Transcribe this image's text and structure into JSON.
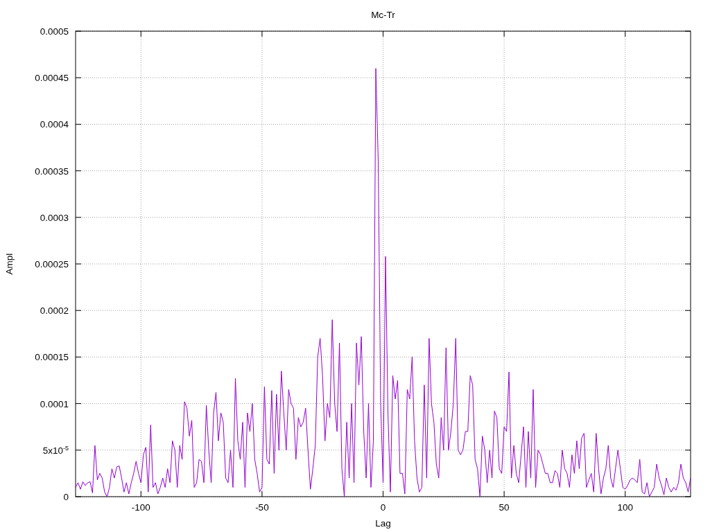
{
  "chart_data": {
    "type": "line",
    "grid": true,
    "title": "Mc-Tr",
    "xlabel": "Lag",
    "ylabel": "Ampl",
    "xlim": [
      -127,
      127
    ],
    "ylim": [
      0,
      0.0005
    ],
    "xticks": [
      -100,
      -50,
      0,
      50,
      100
    ],
    "yticks": [
      0,
      {
        "value": 5e-05,
        "label": "5x10$^{-5}$"
      },
      {
        "value": 0.0001,
        "label": "0.0001"
      },
      {
        "value": 0.00015,
        "label": "0.00015"
      },
      {
        "value": 0.0002,
        "label": "0.0002"
      },
      {
        "value": 0.00025,
        "label": "0.00025"
      },
      {
        "value": 0.0003,
        "label": "0.0003"
      },
      {
        "value": 0.00035,
        "label": "0.00035"
      },
      {
        "value": 0.0004,
        "label": "0.0004"
      },
      {
        "value": 0.00045,
        "label": "0.00045"
      },
      {
        "value": 0.0005,
        "label": "0.0005"
      }
    ],
    "x": [
      -127,
      -126,
      -125,
      -124,
      -123,
      -122,
      -121,
      -120,
      -119,
      -118,
      -117,
      -116,
      -115,
      -114,
      -113,
      -112,
      -111,
      -110,
      -109,
      -108,
      -107,
      -106,
      -105,
      -104,
      -103,
      -102,
      -101,
      -100,
      -99,
      -98,
      -97,
      -96,
      -95,
      -94,
      -93,
      -92,
      -91,
      -90,
      -89,
      -88,
      -87,
      -86,
      -85,
      -84,
      -83,
      -82,
      -81,
      -80,
      -79,
      -78,
      -77,
      -76,
      -75,
      -74,
      -73,
      -72,
      -71,
      -70,
      -69,
      -68,
      -67,
      -66,
      -65,
      -64,
      -63,
      -62,
      -61,
      -60,
      -59,
      -58,
      -57,
      -56,
      -55,
      -54,
      -53,
      -52,
      -51,
      -50,
      -49,
      -48,
      -47,
      -46,
      -45,
      -44,
      -43,
      -42,
      -41,
      -40,
      -39,
      -38,
      -37,
      -36,
      -35,
      -34,
      -33,
      -32,
      -31,
      -30,
      -29,
      -28,
      -27,
      -26,
      -25,
      -24,
      -23,
      -22,
      -21,
      -20,
      -19,
      -18,
      -17,
      -16,
      -15,
      -14,
      -13,
      -12,
      -11,
      -10,
      -9,
      -8,
      -7,
      -6,
      -5,
      -4,
      -3,
      -2,
      -1,
      0,
      1,
      2,
      3,
      4,
      5,
      6,
      7,
      8,
      9,
      10,
      11,
      12,
      13,
      14,
      15,
      16,
      17,
      18,
      19,
      20,
      21,
      22,
      23,
      24,
      25,
      26,
      27,
      28,
      29,
      30,
      31,
      32,
      33,
      34,
      35,
      36,
      37,
      38,
      39,
      40,
      41,
      42,
      43,
      44,
      45,
      46,
      47,
      48,
      49,
      50,
      51,
      52,
      53,
      54,
      55,
      56,
      57,
      58,
      59,
      60,
      61,
      62,
      63,
      64,
      65,
      66,
      67,
      68,
      69,
      70,
      71,
      72,
      73,
      74,
      75,
      76,
      77,
      78,
      79,
      80,
      81,
      82,
      83,
      84,
      85,
      86,
      87,
      88,
      89,
      90,
      91,
      92,
      93,
      94,
      95,
      96,
      97,
      98,
      99,
      100,
      101,
      102,
      103,
      104,
      105,
      106,
      107,
      108,
      109,
      110,
      111,
      112,
      113,
      114,
      115,
      116,
      117,
      118,
      119,
      120,
      121,
      122,
      123,
      124,
      125,
      126,
      127
    ],
    "series": [
      {
        "color": "#9400d3",
        "values": [
          1e-05,
          1.5e-05,
          8e-06,
          1.6e-05,
          1.2e-05,
          1.5e-05,
          1.6e-05,
          4e-06,
          5.5e-05,
          1.8e-05,
          2.5e-05,
          2e-05,
          5e-06,
          0,
          1e-05,
          3e-05,
          2e-05,
          3.2e-05,
          3.3e-05,
          2e-05,
          5e-06,
          1.5e-05,
          3e-06,
          1.5e-05,
          2.5e-05,
          3.8e-05,
          2.5e-05,
          1.5e-05,
          4.5e-05,
          5.3e-05,
          5e-06,
          7.7e-05,
          1e-05,
          1.5e-05,
          3e-06,
          1e-05,
          2e-05,
          1e-05,
          3e-05,
          1.5e-05,
          6e-05,
          5e-05,
          1e-05,
          5.5e-05,
          4e-05,
          0.000102,
          9.5e-05,
          6.5e-05,
          8.2e-05,
          1e-05,
          1.5e-05,
          4e-05,
          3.8e-05,
          1.5e-05,
          9.8e-05,
          5e-05,
          1.5e-05,
          9e-05,
          0.000112,
          6e-05,
          9e-05,
          8e-05,
          2e-05,
          1.5e-05,
          5e-05,
          1e-05,
          0.000127,
          6e-05,
          4e-05,
          8e-05,
          1e-05,
          9e-05,
          7e-05,
          0.0001,
          4e-05,
          2.5e-05,
          5e-06,
          1e-05,
          0.000118,
          4e-05,
          3.5e-05,
          0.000114,
          2.5e-05,
          0.00011,
          5e-05,
          0.000135,
          9e-05,
          5e-05,
          0.000115,
          0.0001,
          9.5e-05,
          4e-05,
          8.5e-05,
          7.5e-05,
          8e-05,
          9.5e-05,
          5e-05,
          8e-06,
          3e-05,
          5.5e-05,
          0.00015,
          0.00017,
          0.00013,
          6e-05,
          0.0001,
          8.5e-05,
          0.00019,
          0.0001,
          7e-05,
          0.000165,
          3e-05,
          0,
          8e-05,
          2e-05,
          0.0001,
          1.5e-05,
          0.000165,
          0.00012,
          0.000172,
          7e-05,
          2e-05,
          0.0001,
          1e-05,
          6e-05,
          0.00046,
          0.00036,
          0.0001,
          1.5e-05,
          0.000258,
          9e-05,
          5e-06,
          0.00013,
          0.000105,
          0.000125,
          2.5e-05,
          2.5e-05,
          3e-06,
          0.000115,
          0.000105,
          0.00015,
          6e-05,
          2e-05,
          5e-06,
          1e-05,
          0.00012,
          2e-05,
          0.00017,
          0.0001,
          8e-05,
          3.5e-05,
          2e-05,
          8.5e-05,
          5e-05,
          0.00016,
          5e-05,
          7e-05,
          0.0001,
          0.00017,
          5e-05,
          4.5e-05,
          5e-05,
          7e-05,
          7e-05,
          0.00013,
          0.00012,
          4e-05,
          3e-05,
          0,
          6.5e-05,
          5e-05,
          1.5e-05,
          5e-05,
          2e-05,
          9.2e-05,
          8.5e-05,
          3e-05,
          2.5e-05,
          7.5e-05,
          7e-05,
          0.000134,
          2e-05,
          5.5e-05,
          2.5e-05,
          1.5e-05,
          4.5e-05,
          7.5e-05,
          1e-05,
          7e-05,
          2e-05,
          0.000115,
          1e-05,
          5e-05,
          4.5e-05,
          3.5e-05,
          2.5e-05,
          2.5e-05,
          1.5e-05,
          1.5e-05,
          2.8e-05,
          2.5e-05,
          1e-05,
          5e-05,
          3e-05,
          2.5e-05,
          1e-05,
          4.5e-05,
          2.5e-05,
          6e-05,
          3e-05,
          6.3e-05,
          6.8e-05,
          1e-05,
          1.8e-05,
          2.5e-05,
          5e-06,
          6.8e-05,
          3e-05,
          3e-06,
          2e-05,
          3e-05,
          5.5e-05,
          2e-05,
          1e-05,
          3e-05,
          5e-05,
          3e-05,
          1e-05,
          8e-06,
          1.2e-05,
          1.8e-05,
          2e-05,
          1.8e-05,
          1.5e-05,
          4e-05,
          5e-06,
          3e-06,
          1.5e-05,
          0,
          5e-06,
          1e-05,
          3.5e-05,
          2e-05,
          1.2e-05,
          2e-06,
          2e-05,
          1e-05,
          5e-06,
          1e-05,
          7e-06,
          1.5e-05,
          3.5e-05,
          2e-05,
          1.5e-05,
          5e-06,
          2e-05
        ]
      }
    ]
  }
}
